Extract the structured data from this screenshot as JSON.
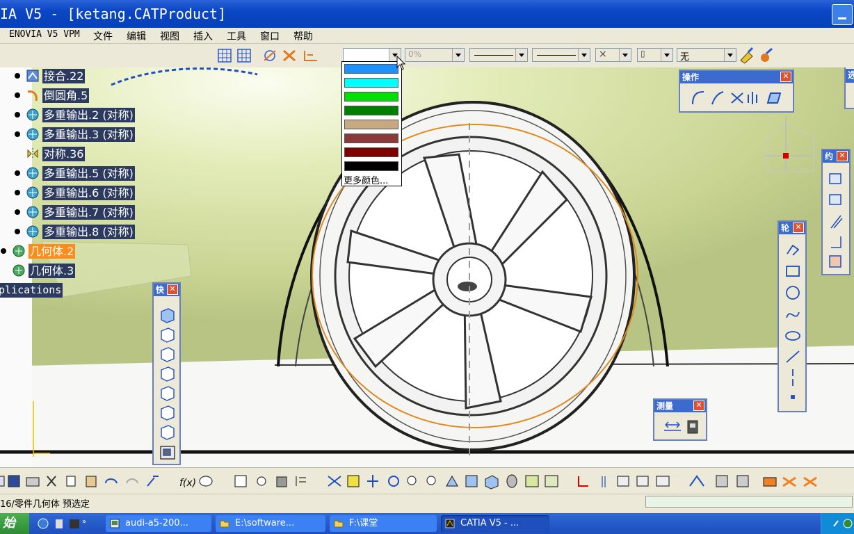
{
  "window": {
    "title": "IA V5 - [ketang.CATProduct]"
  },
  "menu": [
    "ENOVIA V5 VPM",
    "文件",
    "编辑",
    "视图",
    "插入",
    "工具",
    "窗口",
    "帮助"
  ],
  "toolbar": {
    "color_combo_value": "",
    "transparency_value": "0%",
    "layer_value": "无"
  },
  "color_dropdown": {
    "swatches": [
      "#1e90ff",
      "#00ffff",
      "#00e000",
      "#008000",
      "#c8a882",
      "#8b3a3a",
      "#800000",
      "#000000"
    ],
    "more_colors_label": "更多颜色..."
  },
  "tree": {
    "items": [
      {
        "label": "接合.22",
        "icon": "join-icon"
      },
      {
        "label": "倒圆角.5",
        "icon": "fillet-icon"
      },
      {
        "label": "多重输出.2 (对称)",
        "icon": "multi-output-icon"
      },
      {
        "label": "多重输出.3 (对称)",
        "icon": "multi-output-icon"
      },
      {
        "label": "对称.36",
        "icon": "symmetry-icon"
      },
      {
        "label": "多重输出.5 (对称)",
        "icon": "multi-output-icon"
      },
      {
        "label": "多重输出.6 (对称)",
        "icon": "multi-output-icon"
      },
      {
        "label": "多重输出.7 (对称)",
        "icon": "multi-output-icon"
      },
      {
        "label": "多重输出.8 (对称)",
        "icon": "multi-output-icon"
      },
      {
        "label": "几何体.2",
        "icon": "body-icon",
        "selected": true
      },
      {
        "label": "几何体.3",
        "icon": "body-icon"
      },
      {
        "label": "plications",
        "icon": ""
      }
    ]
  },
  "palettes": {
    "operation": {
      "title": "操作"
    },
    "constraint": {
      "title": "约"
    },
    "profile": {
      "title": "轮"
    },
    "quick_view": {
      "title": "快"
    },
    "measure": {
      "title": "测量"
    },
    "edge_partial": {
      "title": "选"
    }
  },
  "status": {
    "text": "16/零件几何体 预选定"
  },
  "taskbar": {
    "start_label": "始",
    "tasks": [
      {
        "label": "audi-a5-200...",
        "icon": "image-icon"
      },
      {
        "label": "E:\\software...",
        "icon": "folder-icon"
      },
      {
        "label": "F:\\课堂",
        "icon": "folder-icon"
      },
      {
        "label": "CATIA V5 - ...",
        "icon": "catia-icon",
        "active": true
      }
    ]
  }
}
